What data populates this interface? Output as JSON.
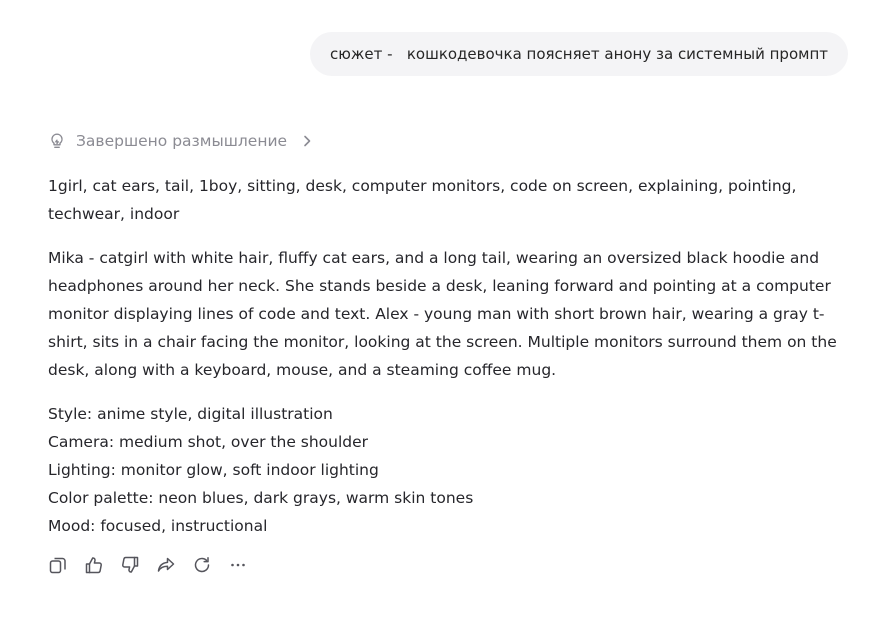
{
  "user_message": {
    "text": "сюжет -   кошкодевочка поясняет анону за системный промпт"
  },
  "thinking": {
    "label": "Завершено размышление",
    "icon": "lightbulb-icon",
    "expand_icon": "chevron-right-icon"
  },
  "response": {
    "tags": "1girl, cat ears, tail, 1boy, sitting, desk, computer monitors, code on screen, explaining, pointing, techwear, indoor",
    "description": "Mika - catgirl with white hair, fluffy cat ears, and a long tail, wearing an oversized black hoodie and headphones around her neck. She stands beside a desk, leaning forward and pointing at a computer monitor displaying lines of code and text. Alex - young man with short brown hair, wearing a gray t-shirt, sits in a chair facing the monitor, looking at the screen. Multiple monitors surround them on the desk, along with a keyboard, mouse, and a steaming coffee mug.",
    "details": [
      "Style: anime style, digital illustration",
      "Camera: medium shot, over the shoulder",
      "Lighting: monitor glow, soft indoor lighting",
      "Color palette: neon blues, dark grays, warm skin tones",
      "Mood: focused, instructional"
    ]
  },
  "actions": {
    "icons": [
      "copy-icon",
      "thumbs-up-icon",
      "thumbs-down-icon",
      "share-icon",
      "regenerate-icon",
      "more-icon"
    ]
  },
  "colors": {
    "bubble_bg": "#f4f4f6",
    "muted_text": "#8b8b93",
    "body_text": "#26262b",
    "icon_stroke": "#55555c"
  }
}
